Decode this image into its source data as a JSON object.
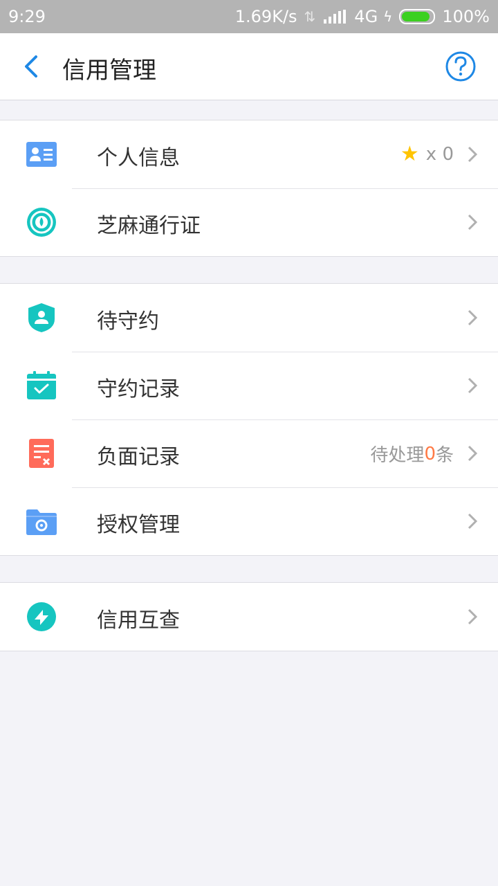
{
  "status_bar": {
    "time": "9:29",
    "net_speed": "1.69K/s",
    "network": "4G",
    "battery": "100%"
  },
  "nav": {
    "title": "信用管理"
  },
  "groups": [
    [
      {
        "label": "个人信息",
        "right_text": "x 0"
      },
      {
        "label": "芝麻通行证"
      }
    ],
    [
      {
        "label": "待守约"
      },
      {
        "label": "守约记录"
      },
      {
        "label": "负面记录",
        "pending_prefix": "待处理",
        "pending_count": "0",
        "pending_suffix": "条"
      },
      {
        "label": "授权管理"
      }
    ],
    [
      {
        "label": "信用互查"
      }
    ]
  ],
  "colors": {
    "accent_blue": "#1e88e5",
    "teal": "#16c5c0",
    "red": "#ff6b5a",
    "highlight_orange": "#ff7a45",
    "star": "#ffc400"
  }
}
